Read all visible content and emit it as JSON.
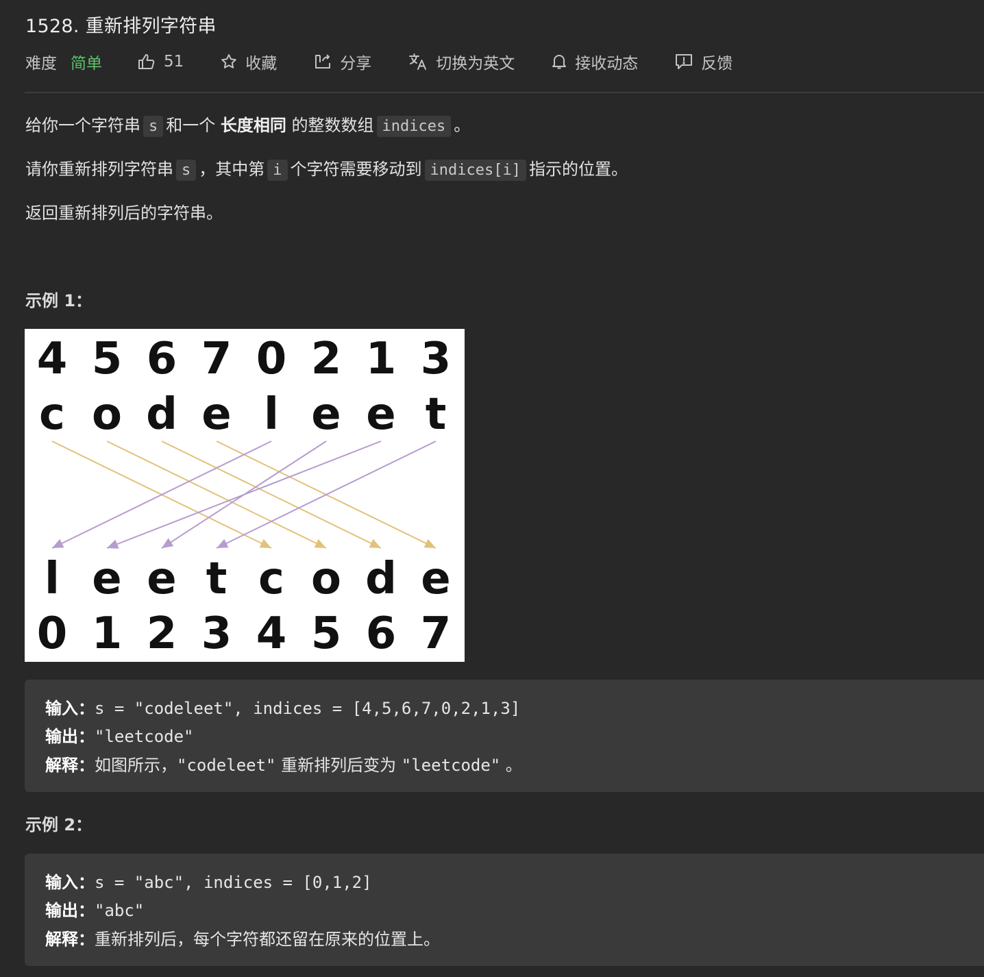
{
  "problem": {
    "title": "1528. 重新排列字符串"
  },
  "toolbar": {
    "difficulty_label": "难度",
    "difficulty_value": "简单",
    "difficulty_color": "#5cc16a",
    "likes_icon": "thumbs-up-icon",
    "likes_count": "51",
    "favorite_icon": "star-icon",
    "favorite_label": "收藏",
    "share_icon": "share-icon",
    "share_label": "分享",
    "translate_icon": "translate-icon",
    "translate_label": "切换为英文",
    "notify_icon": "bell-icon",
    "notify_label": "接收动态",
    "feedback_icon": "feedback-icon",
    "feedback_label": "反馈"
  },
  "description": {
    "p1_a": "给你一个字符串",
    "p1_code1": "s",
    "p1_b": "和一个",
    "p1_bold": "长度相同",
    "p1_c": "的整数数组",
    "p1_code2": "indices",
    "p1_d": "。",
    "p2_a": "请你重新排列字符串",
    "p2_code1": "s",
    "p2_b": "，其中第",
    "p2_code2": "i",
    "p2_c": "个字符需要移动到",
    "p2_code3": "indices[i]",
    "p2_d": "指示的位置。",
    "p3": "返回重新排列后的字符串。"
  },
  "example1": {
    "title": "示例 1：",
    "figure": {
      "top_indices": [
        "4",
        "5",
        "6",
        "7",
        "0",
        "2",
        "1",
        "3"
      ],
      "top_chars": [
        "c",
        "o",
        "d",
        "e",
        "l",
        "e",
        "e",
        "t"
      ],
      "bottom_chars": [
        "l",
        "e",
        "e",
        "t",
        "c",
        "o",
        "d",
        "e"
      ],
      "bottom_indices": [
        "0",
        "1",
        "2",
        "3",
        "4",
        "5",
        "6",
        "7"
      ],
      "arrow_color_right": "#e2c27a",
      "arrow_color_left": "#b69ccf"
    },
    "input_label": "输入：",
    "input_value": "s = \"codeleet\", indices = [4,5,6,7,0,2,1,3]",
    "output_label": "输出：",
    "output_value": "\"leetcode\"",
    "explain_label": "解释：",
    "explain_a": "如图所示，",
    "explain_code1": "\"codeleet\"",
    "explain_b": " 重新排列后变为 ",
    "explain_code2": "\"leetcode\"",
    "explain_c": " 。"
  },
  "example2": {
    "title": "示例 2：",
    "input_label": "输入：",
    "input_value": "s = \"abc\", indices = [0,1,2]",
    "output_label": "输出：",
    "output_value": "\"abc\"",
    "explain_label": "解释：",
    "explain_text": "重新排列后，每个字符都还留在原来的位置上。"
  }
}
